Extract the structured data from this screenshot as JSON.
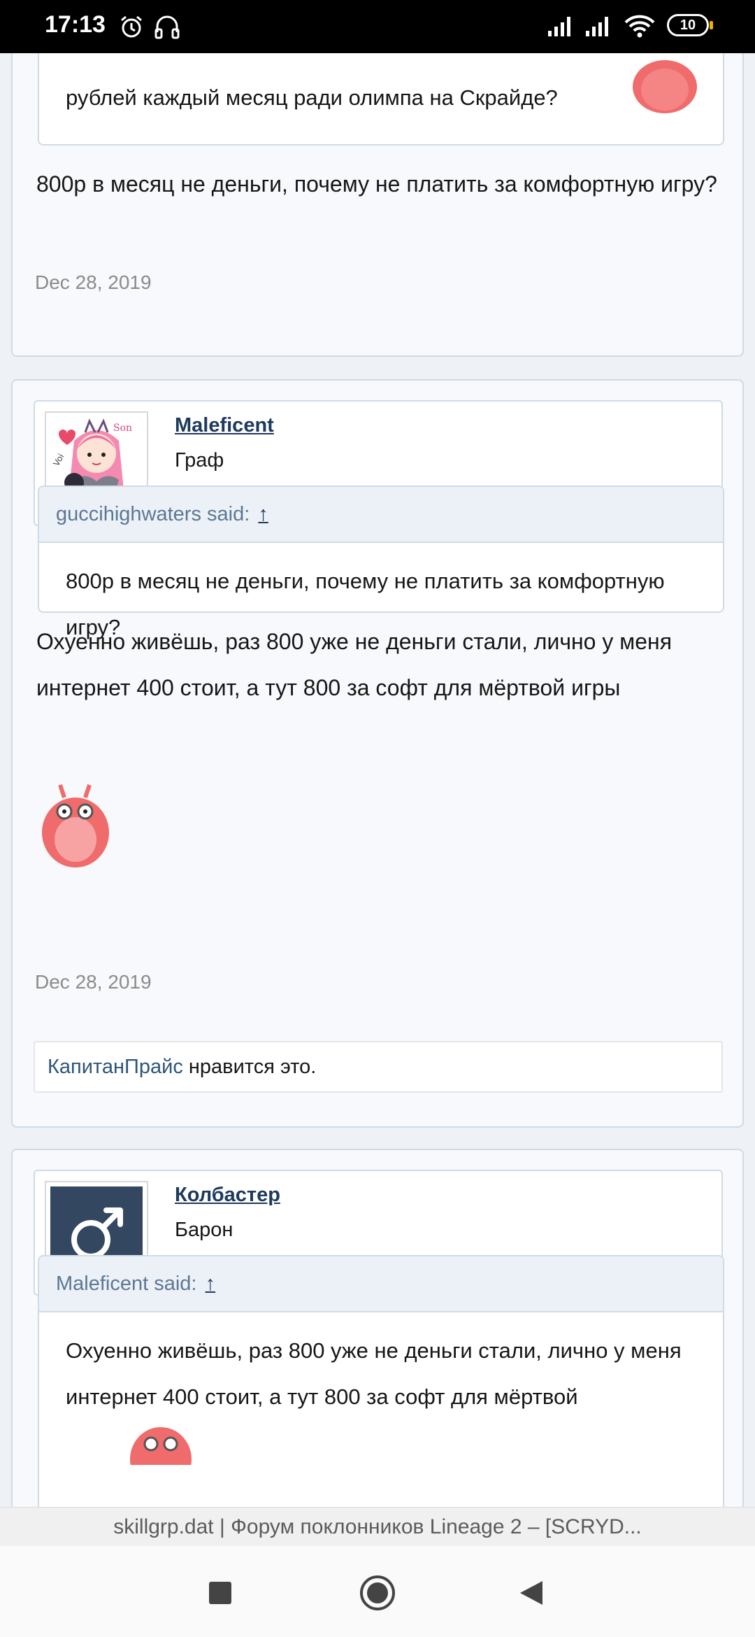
{
  "status_bar": {
    "time": "17:13",
    "battery": "10"
  },
  "posts": [
    {
      "quote_tail": "рублей каждый месяц ради олимпа на Скрайде?",
      "message": "800р в месяц не деньги, почему не платить за комфортную игру?",
      "date": "Dec 28, 2019"
    },
    {
      "username": "Maleficent",
      "user_title": "Граф",
      "quote_author": "guccihighwaters said:",
      "quote_arrow": "↑",
      "quote_text": "800р в месяц не деньги, почему не платить за комфортную игру?",
      "message": "Охуенно живёшь, раз 800 уже не деньги стали, лично у меня интернет 400 стоит, а тут 800 за софт для мёртвой игры",
      "date": "Dec 28, 2019",
      "liker": "КапитанПрайс",
      "likes_suffix": " нравится это."
    },
    {
      "username": "Колбастер",
      "user_title": "Барон",
      "quote_author": "Maleficent said:",
      "quote_arrow": "↑",
      "quote_text": "Охуенно живёшь, раз 800 уже не деньги стали, лично у меня интернет 400 стоит, а тут 800 за софт для мёртвой"
    }
  ],
  "page_title": "skillgrp.dat | Форум поклонников Lineage 2 – [SCRYD...",
  "colors": {
    "accent": "#1d3a5c",
    "border": "#cfdbe7",
    "smiley": "#f06b6b"
  },
  "icons": [
    "alarm-icon",
    "headphones-icon",
    "signal-icon",
    "wifi-icon",
    "battery-icon",
    "male-icon",
    "recents-icon",
    "home-icon",
    "back-icon"
  ]
}
